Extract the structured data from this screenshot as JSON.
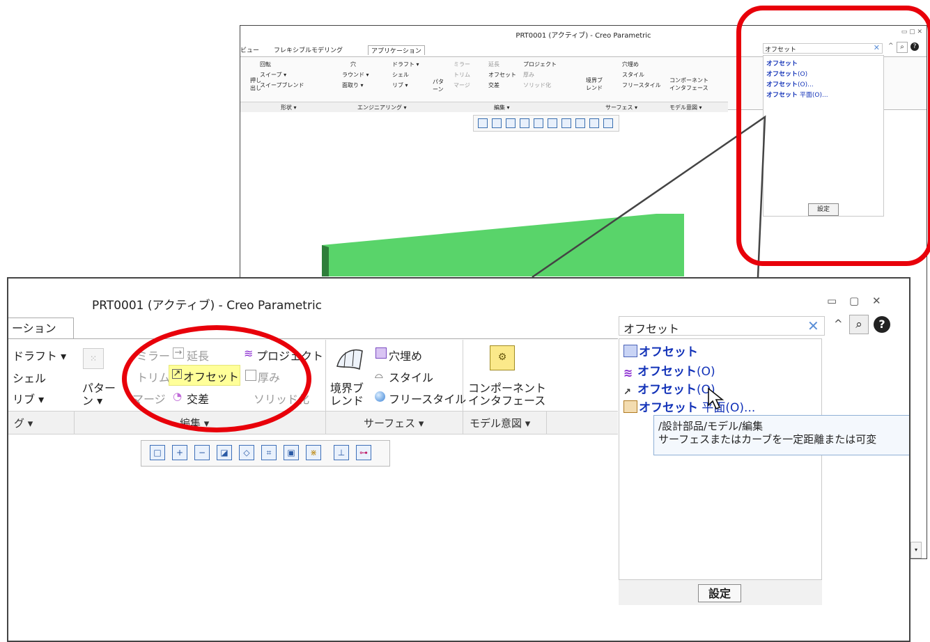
{
  "small_window": {
    "title": "PRT0001 (アクティブ) - Creo Parametric",
    "tabs": [
      "ビュー",
      "フレキシブルモデリング",
      "アプリケーション"
    ],
    "shape_items": [
      "回転",
      "スイープ ▾",
      "スイープブレンド",
      "押し出し"
    ],
    "engineering_items": [
      "穴",
      "ラウンド ▾",
      "面取り ▾",
      "ドラフト ▾",
      "シェル",
      "リブ ▾"
    ],
    "edit_items": [
      "ミラー",
      "延長",
      "プロジェクト",
      "トリム",
      "オフセット",
      "厚み",
      "マージ",
      "交差",
      "ソリッド化",
      "パターン"
    ],
    "surface_items": [
      "穴埋め",
      "スタイル",
      "フリースタイル",
      "境界ブレンド"
    ],
    "component_item": "コンポーネントインタフェース",
    "groups": [
      "形状 ▾",
      "エンジニアリング ▾",
      "編集 ▾",
      "サーフェス ▾",
      "モデル意図 ▾"
    ],
    "search_value": "オフセット",
    "results": [
      {
        "bold": "オフセット",
        "suffix": ""
      },
      {
        "bold": "オフセット",
        "suffix": "(O)"
      },
      {
        "bold": "オフセット",
        "suffix": "(O)..."
      },
      {
        "bold": "オフセット",
        "suffix": " 平面(O)..."
      }
    ],
    "setting_label": "設定"
  },
  "big_window": {
    "title": "PRT0001 (アクティブ) - Creo Parametric",
    "tab_partial": "ーション",
    "left_items": [
      "ドラフト ▾",
      "シェル",
      "リブ ▾"
    ],
    "edit": {
      "mirror": "ミラー",
      "extend": "延長",
      "project": "プロジェクト",
      "trim": "トリム",
      "offset": "オフセット",
      "thicken": "厚み",
      "merge": "マージ",
      "intersect": "交差",
      "solidify": "ソリッド化",
      "pattern_line1": "パター",
      "pattern_line2": "ン ▾"
    },
    "surface": {
      "fill": "穴埋め",
      "style": "スタイル",
      "freestyle": "フリースタイル",
      "boundary_line1": "境界ブ",
      "boundary_line2": "レンド"
    },
    "component": {
      "line1": "コンポーネント",
      "line2": "インタフェース"
    },
    "groups": {
      "eng": "グ ▾",
      "edit": "編集 ▾",
      "surface": "サーフェス ▾",
      "intent": "モデル意図 ▾"
    },
    "search_value": "オフセット",
    "results": [
      {
        "bold": "オフセット",
        "suffix": ""
      },
      {
        "bold": "オフセット",
        "suffix": "(O)"
      },
      {
        "bold": "オフセット",
        "suffix": "(O)"
      },
      {
        "bold": "オフセット",
        "suffix": " 平面(O)..."
      }
    ],
    "tooltip": {
      "line1": "/設計部品/モデル/編集",
      "line2": "サーフェスまたはカーブを一定距離または可変"
    },
    "setting_label": "設定"
  },
  "colors": {
    "highlight_oval": "#e8000a",
    "result_text": "#1232b8",
    "model_green": "#59d46a",
    "offset_highlight": "#ffff99"
  }
}
